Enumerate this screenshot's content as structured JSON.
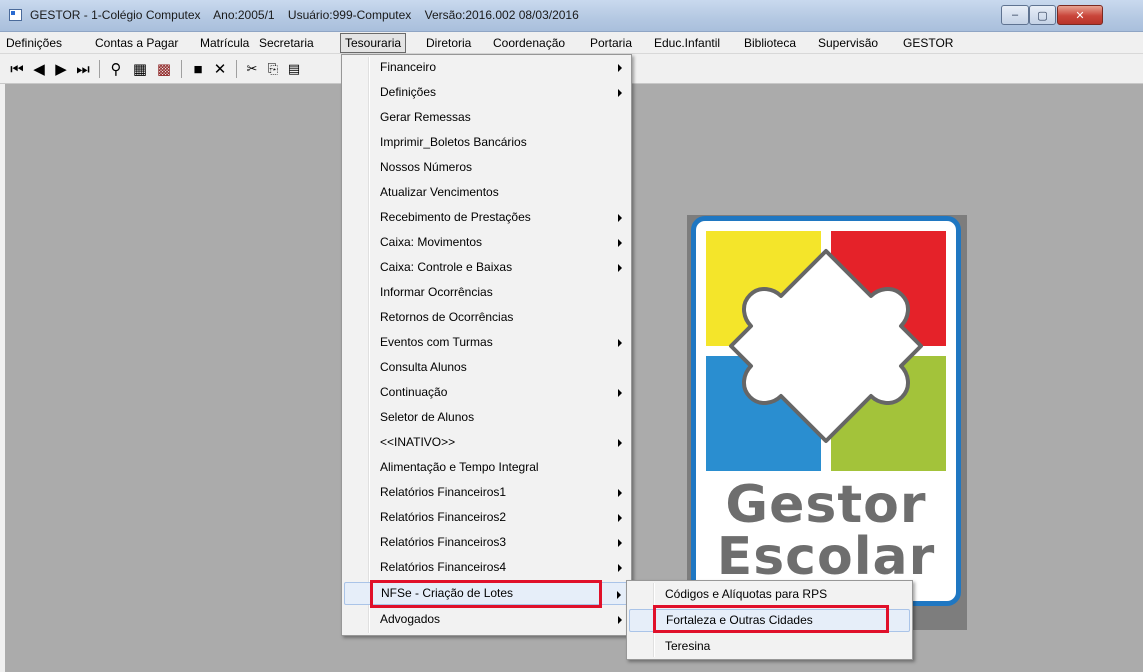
{
  "window": {
    "title": "GESTOR - 1-Colégio Computex    Ano:2005/1    Usuário:999-Computex    Versão:2016.002 08/03/2016",
    "controls": {
      "minimize": "–",
      "maximize": "▢",
      "close": "✕"
    }
  },
  "menubar": {
    "items": [
      "Definições",
      "Contas a Pagar",
      "Matrícula",
      "Secretaria",
      "Tesouraria",
      "Diretoria",
      "Coordenação",
      "Portaria",
      "Educ.Infantil",
      "Biblioteca",
      "Supervisão",
      "GESTOR"
    ],
    "active": "Tesouraria"
  },
  "toolbar": {
    "buttons": [
      {
        "name": "first-record",
        "glyph": "⏮"
      },
      {
        "name": "prev-record",
        "glyph": "◀"
      },
      {
        "name": "next-record",
        "glyph": "▶"
      },
      {
        "name": "last-record",
        "glyph": "⏭"
      },
      {
        "name": "search",
        "glyph": "⚲"
      },
      {
        "name": "filter",
        "glyph": "▦"
      },
      {
        "name": "clear-filter",
        "glyph": "▩"
      },
      {
        "name": "save",
        "glyph": "■"
      },
      {
        "name": "cancel",
        "glyph": "✕"
      },
      {
        "name": "cut",
        "glyph": "✂"
      },
      {
        "name": "copy",
        "glyph": "⎘"
      },
      {
        "name": "paste",
        "glyph": "▤"
      }
    ]
  },
  "tesouraria_menu": {
    "items": [
      {
        "label": "Financeiro",
        "submenu": true
      },
      {
        "label": "Definições",
        "submenu": true
      },
      {
        "label": "Gerar Remessas",
        "submenu": false
      },
      {
        "label": "Imprimir_Boletos Bancários",
        "submenu": false
      },
      {
        "label": "Nossos Números",
        "submenu": false
      },
      {
        "label": "Atualizar Vencimentos",
        "submenu": false
      },
      {
        "label": "Recebimento de Prestações",
        "submenu": true
      },
      {
        "label": "Caixa: Movimentos",
        "submenu": true
      },
      {
        "label": "Caixa: Controle e Baixas",
        "submenu": true
      },
      {
        "label": "Informar Ocorrências",
        "submenu": false
      },
      {
        "label": "Retornos de Ocorrências",
        "submenu": false
      },
      {
        "label": "Eventos com Turmas",
        "submenu": true
      },
      {
        "label": "Consulta Alunos",
        "submenu": false
      },
      {
        "label": "Continuação",
        "submenu": true
      },
      {
        "label": "Seletor de Alunos",
        "submenu": false
      },
      {
        "label": "<<INATIVO>>",
        "submenu": true
      },
      {
        "label": "Alimentação e Tempo Integral",
        "submenu": false
      },
      {
        "label": "Relatórios Financeiros1",
        "submenu": true
      },
      {
        "label": "Relatórios Financeiros2",
        "submenu": true
      },
      {
        "label": "Relatórios Financeiros3",
        "submenu": true
      },
      {
        "label": "Relatórios Financeiros4",
        "submenu": true
      },
      {
        "label": "NFSe - Criação de Lotes",
        "submenu": true,
        "highlighted": true
      },
      {
        "label": "Advogados",
        "submenu": true
      }
    ]
  },
  "nfse_submenu": {
    "items": [
      {
        "label": "Códigos e Alíquotas para RPS",
        "highlighted": false
      },
      {
        "label": "Fortaleza e Outras Cidades",
        "highlighted": true
      },
      {
        "label": "Teresina",
        "highlighted": false
      }
    ]
  },
  "logo": {
    "line1": "Gestor",
    "line2": "Escolar",
    "colors": {
      "yellow": "#f4e52a",
      "red": "#e52229",
      "blue": "#2a8ed0",
      "green": "#a3c33a",
      "border": "#1f77c2",
      "text": "#6e6e6e"
    }
  },
  "annotation_color": "#e0102a"
}
